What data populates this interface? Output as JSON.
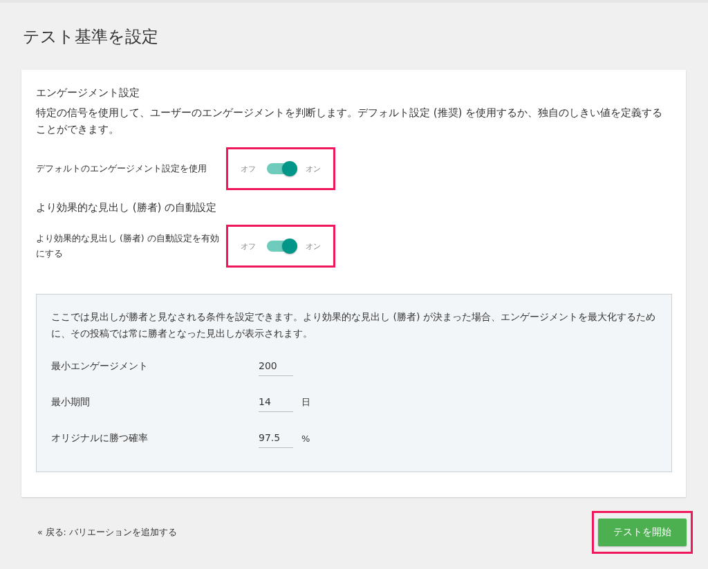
{
  "page_title": "テスト基準を設定",
  "engagement": {
    "heading": "エンゲージメント設定",
    "description": "特定の信号を使用して、ユーザーのエンゲージメントを判断します。デフォルト設定 (推奨) を使用するか、独自のしきい値を定義することができます。",
    "toggle": {
      "label": "デフォルトのエンゲージメント設定を使用",
      "off_label": "オフ",
      "on_label": "オン",
      "on": true,
      "highlighted": true
    }
  },
  "auto_winner": {
    "heading": "より効果的な見出し (勝者) の自動設定",
    "toggle": {
      "label": "より効果的な見出し (勝者) の自動設定を有効にする",
      "off_label": "オフ",
      "on_label": "オン",
      "on": true,
      "highlighted": true
    }
  },
  "criteria": {
    "description": "ここでは見出しが勝者と見なされる条件を設定できます。より効果的な見出し (勝者) が決まった場合、エンゲージメントを最大化するために、その投稿では常に勝者となった見出しが表示されます。",
    "fields": [
      {
        "label": "最小エンゲージメント",
        "value": "200"
      },
      {
        "label": "最小期間",
        "value": "14",
        "unit": "日"
      },
      {
        "label": "オリジナルに勝つ確率",
        "value": "97.5",
        "unit": "%"
      }
    ]
  },
  "footer": {
    "back_link": "« 戻る: バリエーションを追加する",
    "start_button": {
      "label": "テストを開始",
      "highlighted": true
    }
  }
}
